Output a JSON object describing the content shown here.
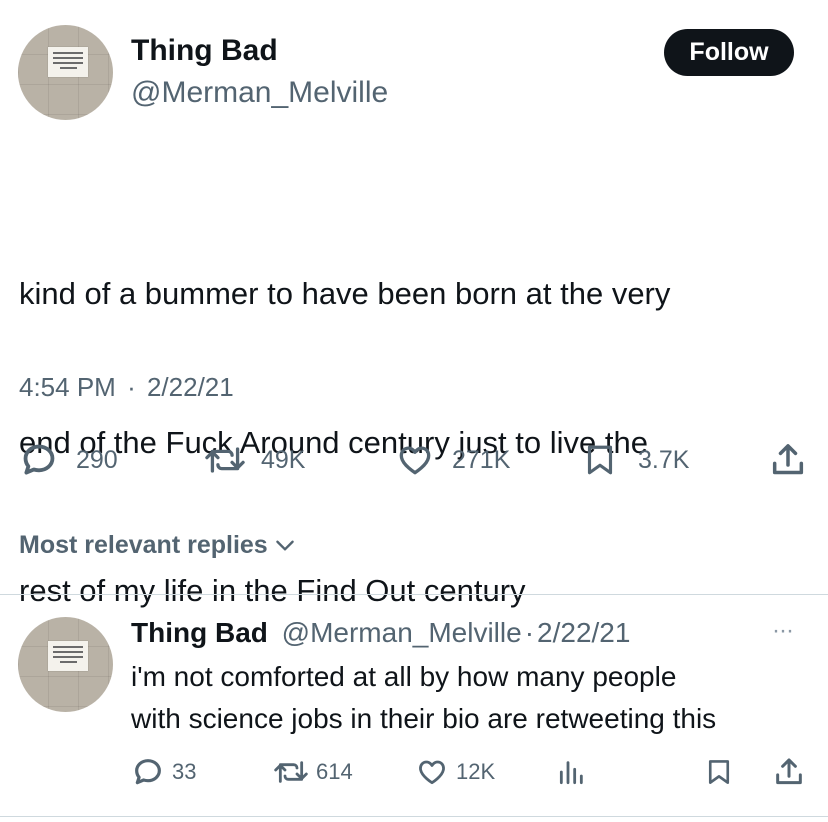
{
  "tweet": {
    "author": {
      "display_name": "Thing Bad",
      "handle": "@Merman_Melville"
    },
    "follow_label": "Follow",
    "text_lines": [
      "kind of a bummer to have been born at the very",
      "end of the Fuck Around century just to live the",
      "rest of my life in the Find Out century"
    ],
    "time": "4:54 PM",
    "separator": "·",
    "date": "2/22/21",
    "stats": {
      "replies": "290",
      "retweets": "49K",
      "likes": "271K",
      "bookmarks": "3.7K"
    }
  },
  "replies_section": {
    "title": "Most relevant replies"
  },
  "reply": {
    "display_name": "Thing Bad",
    "handle": "@Merman_Melville",
    "separator": "·",
    "date": "2/22/21",
    "more": "···",
    "text_lines": [
      "i'm not comforted at all by how many people",
      "with science jobs in their bio are retweeting this"
    ],
    "stats": {
      "replies": "33",
      "retweets": "614",
      "likes": "12K"
    }
  },
  "icons": {
    "reply": "speech-bubble-icon",
    "retweet": "retweet-arrows-icon",
    "like": "heart-icon",
    "bookmark": "bookmark-icon",
    "share": "share-upload-icon",
    "views": "bar-chart-icon",
    "chevron": "chevron-down-icon",
    "more": "more-dots-icon"
  },
  "colors": {
    "text": "#0f1419",
    "secondary": "#536471",
    "follow_bg": "#0f1419",
    "divider": "#cfd9de"
  }
}
